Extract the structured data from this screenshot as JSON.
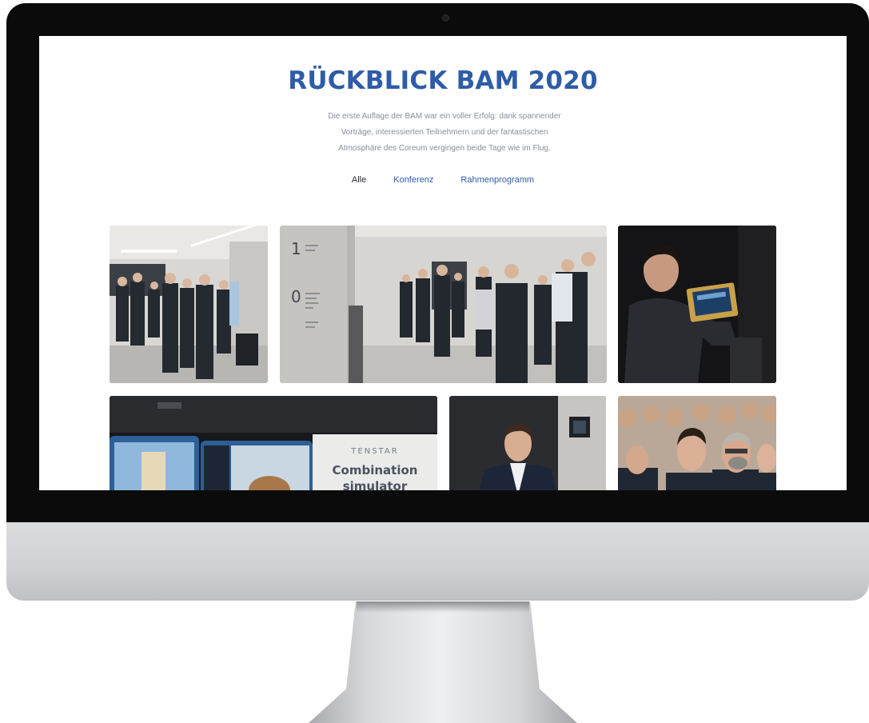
{
  "page": {
    "title": "RÜCKBLICK BAM 2020",
    "intro_lines": [
      "Die erste Auflage der BAM war ein voller Erfolg: dank spannender",
      "Vorträge, interessierten Teilnehmern und der fantastischen",
      "Atmosphäre des Coreum vergingen beide Tage wie im Flug."
    ]
  },
  "filters": [
    {
      "label": "Alle",
      "active": true
    },
    {
      "label": "Konferenz",
      "active": false
    },
    {
      "label": "Rahmenprogramm",
      "active": false
    }
  ],
  "gallery": {
    "signage_digits": [
      "1",
      "0"
    ],
    "banner_brand": "TENSTAR",
    "banner_lines": [
      "Combination",
      "simulator"
    ]
  },
  "colors": {
    "accent": "#2e5ca8",
    "intro_text": "#8a8f9a",
    "bezel": "#0b0b0c"
  }
}
